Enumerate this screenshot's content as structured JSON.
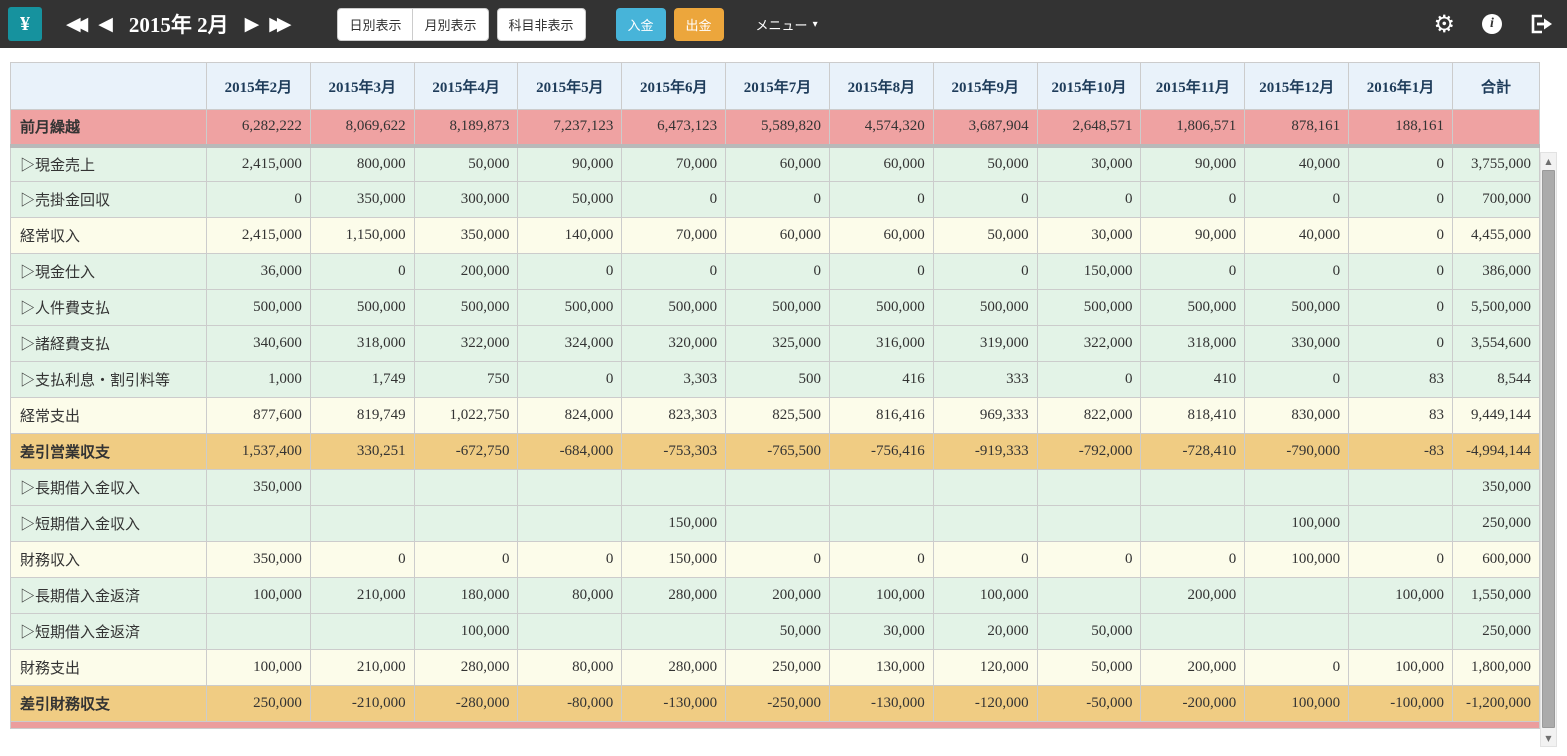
{
  "navbar": {
    "logo_label": "¥",
    "title": "2015年 2月",
    "first_arrow": "◀◀",
    "prev_arrow": "◀",
    "next_arrow": "▶",
    "last_arrow": "▶▶",
    "daily_view_label": "日別表示",
    "monthly_view_label": "月別表示",
    "hide_accounts_label": "科目非表示",
    "deposit_label": "入金",
    "withdrawal_label": "出金",
    "menu_label": "メニュー",
    "menu_caret": "▾",
    "gear_glyph": "⚙",
    "info_glyph": "i"
  },
  "colors": {
    "navbar_bg": "#333333",
    "logo_teal": "#16929e",
    "deposit_blue": "#47b4d9",
    "withdrawal_orange": "#eca63c",
    "header_bg": "#e9f2fa",
    "header_text": "#1e3c5a",
    "carryover_pink": "#efa2a2",
    "detail_green": "#e3f3e7",
    "subtotal_cream": "#fcfcea",
    "balance_orange": "#f0cc83"
  },
  "table": {
    "columns": [
      "",
      "2015年2月",
      "2015年3月",
      "2015年4月",
      "2015年5月",
      "2015年6月",
      "2015年7月",
      "2015年8月",
      "2015年9月",
      "2015年10月",
      "2015年11月",
      "2015年12月",
      "2016年1月",
      "合計"
    ],
    "rows": [
      {
        "label": "前月繰越",
        "type": "carryover",
        "values": [
          "6,282,222",
          "8,069,622",
          "8,189,873",
          "7,237,123",
          "6,473,123",
          "5,589,820",
          "4,574,320",
          "3,687,904",
          "2,648,571",
          "1,806,571",
          "878,161",
          "188,161",
          ""
        ]
      },
      {
        "label": "▷現金売上",
        "type": "detail",
        "values": [
          "2,415,000",
          "800,000",
          "50,000",
          "90,000",
          "70,000",
          "60,000",
          "60,000",
          "50,000",
          "30,000",
          "90,000",
          "40,000",
          "0",
          "3,755,000"
        ]
      },
      {
        "label": "▷売掛金回収",
        "type": "detail",
        "values": [
          "0",
          "350,000",
          "300,000",
          "50,000",
          "0",
          "0",
          "0",
          "0",
          "0",
          "0",
          "0",
          "0",
          "700,000"
        ]
      },
      {
        "label": "経常収入",
        "type": "subtotal",
        "values": [
          "2,415,000",
          "1,150,000",
          "350,000",
          "140,000",
          "70,000",
          "60,000",
          "60,000",
          "50,000",
          "30,000",
          "90,000",
          "40,000",
          "0",
          "4,455,000"
        ]
      },
      {
        "label": "▷現金仕入",
        "type": "detail",
        "values": [
          "36,000",
          "0",
          "200,000",
          "0",
          "0",
          "0",
          "0",
          "0",
          "150,000",
          "0",
          "0",
          "0",
          "386,000"
        ]
      },
      {
        "label": "▷人件費支払",
        "type": "detail",
        "values": [
          "500,000",
          "500,000",
          "500,000",
          "500,000",
          "500,000",
          "500,000",
          "500,000",
          "500,000",
          "500,000",
          "500,000",
          "500,000",
          "0",
          "5,500,000"
        ]
      },
      {
        "label": "▷諸経費支払",
        "type": "detail",
        "values": [
          "340,600",
          "318,000",
          "322,000",
          "324,000",
          "320,000",
          "325,000",
          "316,000",
          "319,000",
          "322,000",
          "318,000",
          "330,000",
          "0",
          "3,554,600"
        ]
      },
      {
        "label": "▷支払利息・割引料等",
        "type": "detail",
        "values": [
          "1,000",
          "1,749",
          "750",
          "0",
          "3,303",
          "500",
          "416",
          "333",
          "0",
          "410",
          "0",
          "83",
          "8,544"
        ]
      },
      {
        "label": "経常支出",
        "type": "subtotal",
        "values": [
          "877,600",
          "819,749",
          "1,022,750",
          "824,000",
          "823,303",
          "825,500",
          "816,416",
          "969,333",
          "822,000",
          "818,410",
          "830,000",
          "83",
          "9,449,144"
        ]
      },
      {
        "label": "差引営業収支",
        "type": "balance",
        "values": [
          "1,537,400",
          "330,251",
          "-672,750",
          "-684,000",
          "-753,303",
          "-765,500",
          "-756,416",
          "-919,333",
          "-792,000",
          "-728,410",
          "-790,000",
          "-83",
          "-4,994,144"
        ]
      },
      {
        "label": "▷長期借入金収入",
        "type": "detail",
        "values": [
          "350,000",
          "",
          "",
          "",
          "",
          "",
          "",
          "",
          "",
          "",
          "",
          "",
          "350,000"
        ]
      },
      {
        "label": "▷短期借入金収入",
        "type": "detail",
        "values": [
          "",
          "",
          "",
          "",
          "150,000",
          "",
          "",
          "",
          "",
          "",
          "100,000",
          "",
          "250,000"
        ]
      },
      {
        "label": "財務収入",
        "type": "subtotal",
        "values": [
          "350,000",
          "0",
          "0",
          "0",
          "150,000",
          "0",
          "0",
          "0",
          "0",
          "0",
          "100,000",
          "0",
          "600,000"
        ]
      },
      {
        "label": "▷長期借入金返済",
        "type": "detail",
        "values": [
          "100,000",
          "210,000",
          "180,000",
          "80,000",
          "280,000",
          "200,000",
          "100,000",
          "100,000",
          "",
          "200,000",
          "",
          "100,000",
          "1,550,000"
        ]
      },
      {
        "label": "▷短期借入金返済",
        "type": "detail",
        "values": [
          "",
          "",
          "100,000",
          "",
          "",
          "50,000",
          "30,000",
          "20,000",
          "50,000",
          "",
          "",
          "",
          "250,000"
        ]
      },
      {
        "label": "財務支出",
        "type": "subtotal",
        "values": [
          "100,000",
          "210,000",
          "280,000",
          "80,000",
          "280,000",
          "250,000",
          "130,000",
          "120,000",
          "50,000",
          "200,000",
          "0",
          "100,000",
          "1,800,000"
        ]
      },
      {
        "label": "差引財務収支",
        "type": "balance",
        "values": [
          "250,000",
          "-210,000",
          "-280,000",
          "-80,000",
          "-130,000",
          "-250,000",
          "-130,000",
          "-120,000",
          "-50,000",
          "-200,000",
          "100,000",
          "-100,000",
          "-1,200,000"
        ]
      }
    ]
  },
  "scrollbar": {
    "up_glyph": "▲",
    "down_glyph": "▼"
  }
}
